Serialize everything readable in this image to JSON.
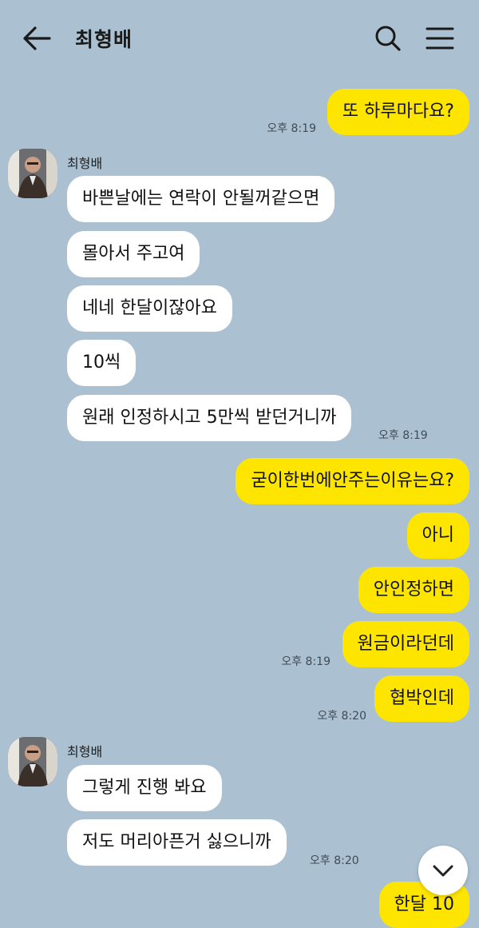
{
  "header": {
    "title": "최형배",
    "back_icon": "back-arrow-icon",
    "search_icon": "search-icon",
    "menu_icon": "menu-icon"
  },
  "sender_name": "최형배",
  "colors": {
    "background": "#abc1d1",
    "my_bubble": "#fee500",
    "their_bubble": "#ffffff"
  },
  "messages": {
    "m1": {
      "text": "또 하루마다요?",
      "time": "오후 8:19"
    },
    "m2": {
      "text": "바쁜날에는 연락이 안될꺼같으면"
    },
    "m3": {
      "text": "몰아서 주고여"
    },
    "m4": {
      "text": "네네 한달이잖아요"
    },
    "m5": {
      "text": "10씩"
    },
    "m6": {
      "text": "원래 인정하시고 5만씩 받던거니까",
      "time": "오후 8:19"
    },
    "m7": {
      "text": "굳이한번에안주는이유는요?"
    },
    "m8": {
      "text": "아니"
    },
    "m9": {
      "text": "안인정하면"
    },
    "m10": {
      "text": "원금이라던데",
      "time": "오후 8:19"
    },
    "m11": {
      "text": "협박인데",
      "time": "오후 8:20"
    },
    "m12": {
      "text": "그렇게 진행 봐요"
    },
    "m13": {
      "text": "저도 머리아픈거 싫으니까",
      "time": "오후 8:20"
    },
    "m14": {
      "text": "한달 10"
    }
  },
  "scroll_button_icon": "chevron-down-icon"
}
